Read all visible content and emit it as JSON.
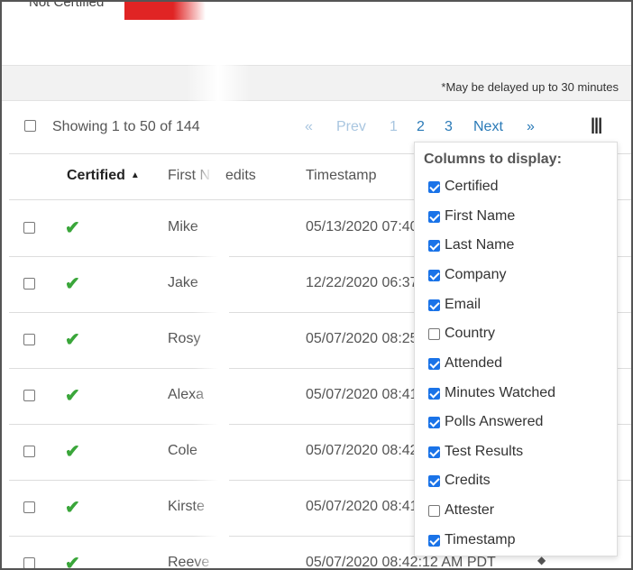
{
  "top": {
    "status_label": "Not Certified"
  },
  "notice": "*May be delayed up to 30 minutes",
  "toolbar": {
    "showing": "Showing 1 to 50 of 144",
    "pager": {
      "first": "«",
      "prev": "Prev",
      "pages": [
        "1",
        "2",
        "3"
      ],
      "next": "Next",
      "last": "»"
    },
    "columns_icon": "column-toggle-icon"
  },
  "table": {
    "headers": {
      "certified": "Certified",
      "first_name": "First N",
      "credits": "edits",
      "timestamp": "Timestamp"
    },
    "rows": [
      {
        "first": "Mike",
        "timestamp": "05/13/2020 07:40"
      },
      {
        "first": "Jake",
        "timestamp": "12/22/2020 06:37"
      },
      {
        "first": "Rosy",
        "timestamp": "05/07/2020 08:25"
      },
      {
        "first": "Alexa",
        "timestamp": "05/07/2020 08:41"
      },
      {
        "first": "Cole",
        "timestamp": "05/07/2020 08:42"
      },
      {
        "first": "Kirste",
        "timestamp": "05/07/2020 08:41"
      },
      {
        "first": "Reeve",
        "timestamp": "05/07/2020 08:42:12 AM PDT"
      }
    ]
  },
  "columns_menu": {
    "title": "Columns to display:",
    "items": [
      {
        "label": "Certified",
        "checked": true
      },
      {
        "label": "First Name",
        "checked": true
      },
      {
        "label": "Last Name",
        "checked": true
      },
      {
        "label": "Company",
        "checked": true
      },
      {
        "label": "Email",
        "checked": true
      },
      {
        "label": "Country",
        "checked": false
      },
      {
        "label": "Attended",
        "checked": true
      },
      {
        "label": "Minutes Watched",
        "checked": true
      },
      {
        "label": "Polls Answered",
        "checked": true
      },
      {
        "label": "Test Results",
        "checked": true
      },
      {
        "label": "Credits",
        "checked": true
      },
      {
        "label": "Attester",
        "checked": false
      },
      {
        "label": "Timestamp",
        "checked": true
      }
    ]
  },
  "colors": {
    "accent": "#1a73e8",
    "check": "#3aa63a",
    "link": "#2a7ab7",
    "status_red": "#e02424"
  }
}
